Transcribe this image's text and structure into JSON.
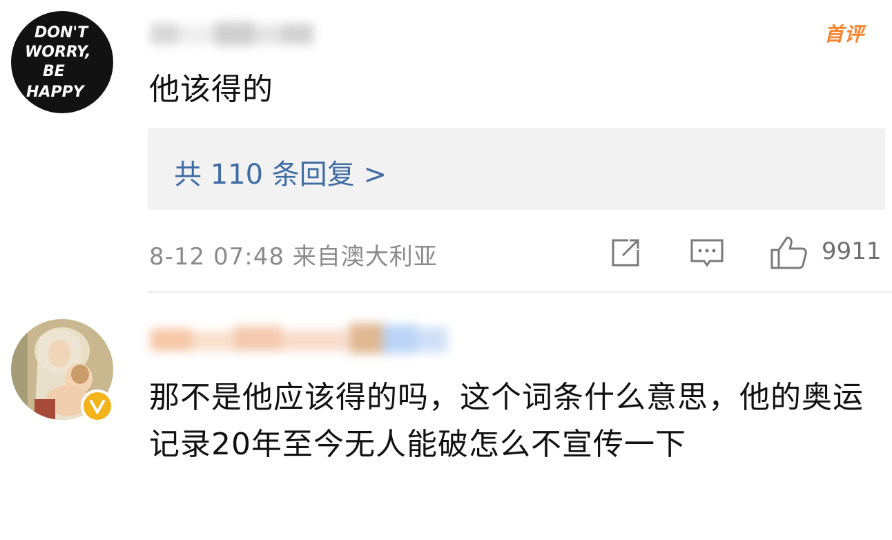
{
  "comment1": {
    "avatar_text": "DON'T WORRY, BE HAPPY",
    "badge": "首评",
    "text": "他该得的",
    "replies_label": "共 110 条回复 >",
    "timestamp": "8-12 07:48 来自澳大利亚",
    "like_count": "9911"
  },
  "comment2": {
    "text": "那不是他应该得的吗，这个词条什么意思，他的奥运记录20年至今无人能破怎么不宣传一下"
  },
  "colors": {
    "reply_link": "#3f6ca3",
    "badge": "#f6822a",
    "verified": "#f3b31b",
    "reply_box_bg": "#f2f2f2"
  },
  "icons": [
    "share-icon",
    "comment-icon",
    "like-icon",
    "verified-icon"
  ]
}
